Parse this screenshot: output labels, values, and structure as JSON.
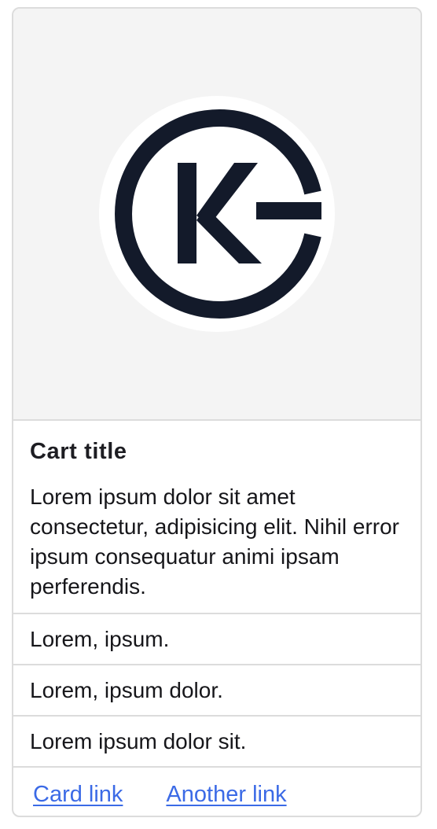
{
  "card": {
    "image": {
      "logo_icon": "gk-monogram-logo",
      "background_color": "#f4f4f4",
      "logo_color": "#131a2a"
    },
    "title": "Cart title",
    "text": "Lorem ipsum dolor sit amet consectetur, adipisicing elit. Nihil error ipsum consequatur animi ipsam perferendis.",
    "list_items": [
      "Lorem, ipsum.",
      "Lorem, ipsum dolor.",
      "Lorem ipsum dolor sit."
    ],
    "links": [
      "Card link",
      "Another link"
    ],
    "link_color": "#3b6ae6"
  }
}
